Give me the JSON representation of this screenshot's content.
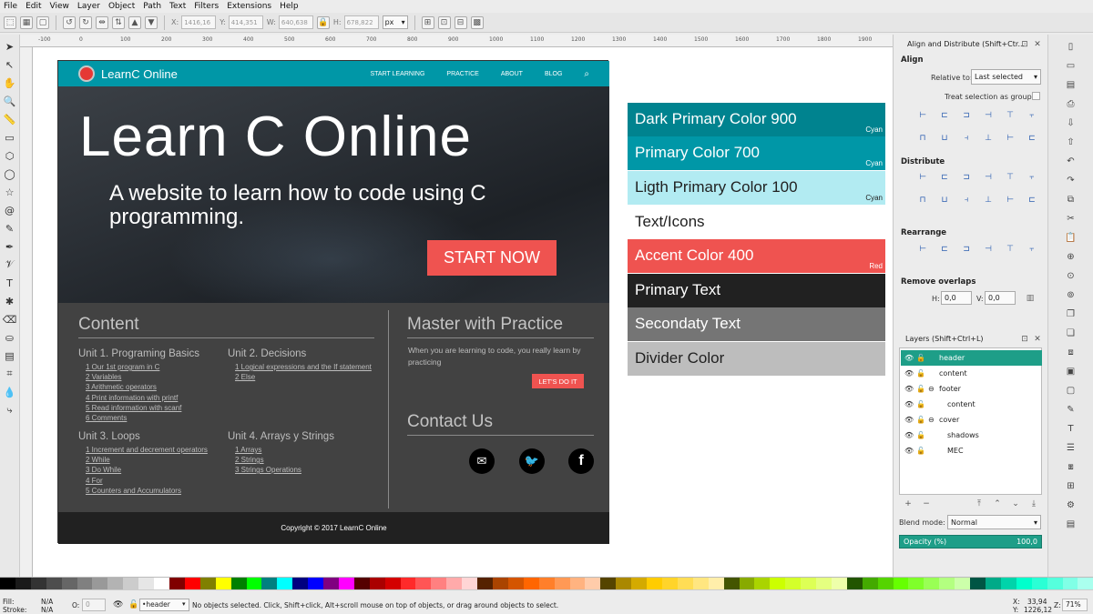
{
  "menubar": [
    "File",
    "Edit",
    "View",
    "Layer",
    "Object",
    "Path",
    "Text",
    "Filters",
    "Extensions",
    "Help"
  ],
  "controls": {
    "x_label": "X:",
    "x_value": "1416,16",
    "y_label": "Y:",
    "y_value": "414,351",
    "w_label": "W:",
    "w_value": "640,638",
    "h_label": "H:",
    "h_value": "678,822",
    "unit": "px"
  },
  "ruler_ticks": [
    "-100",
    "0",
    "100",
    "200",
    "300",
    "400",
    "500",
    "600",
    "700",
    "800",
    "900",
    "1000",
    "1100",
    "1200",
    "1300",
    "1400",
    "1500",
    "1600",
    "1700",
    "1800",
    "1900",
    "2k"
  ],
  "mockup": {
    "brand": "LearnC Online",
    "nav": [
      "START LEARNING",
      "PRACTICE",
      "ABOUT",
      "BLOG"
    ],
    "hero_title": "Learn C Online",
    "hero_subtitle": "A website to learn how to code using C programming.",
    "cta": "START NOW",
    "content_heading": "Content",
    "units": [
      {
        "title": "Unit 1. Programing Basics",
        "lessons": [
          "1 Our 1st program in C",
          "2 Variables",
          "3 Arithmetic operators",
          "4 Print information with printf",
          "5 Read information with scanf",
          "6 Comments"
        ]
      },
      {
        "title": "Unit 2. Decisions",
        "lessons": [
          "1 Logical expressions and the If statement",
          "2 Else"
        ]
      },
      {
        "title": "Unit 3. Loops",
        "lessons": [
          "1 Increment and decrement operators",
          "2 While",
          "3 Do While",
          "4 For",
          "5 Counters and Accumulators"
        ]
      },
      {
        "title": "Unit 4. Arrays y Strings",
        "lessons": [
          "1 Arrays",
          "2 Strings",
          "3 Strings Operations"
        ]
      }
    ],
    "practice_heading": "Master with Practice",
    "practice_text": "When you are learning to code, you really learn by practicing",
    "practice_button": "LET'S DO IT",
    "contact_heading": "Contact Us",
    "footer": "Copyright © 2017 LearnC Online"
  },
  "swatches": [
    {
      "name": "Dark Primary Color 900",
      "tag": "Cyan",
      "bg": "#00838f",
      "fg": "#ffffff"
    },
    {
      "name": "Primary Color 700",
      "tag": "Cyan",
      "bg": "#0097a7",
      "fg": "#ffffff"
    },
    {
      "name": "Ligth Primary Color 100",
      "tag": "Cyan",
      "bg": "#b2ebf2",
      "fg": "#212121"
    },
    {
      "name": "Text/Icons",
      "tag": "",
      "bg": "#ffffff",
      "fg": "#212121"
    },
    {
      "name": "Accent Color 400",
      "tag": "Red",
      "bg": "#ef5350",
      "fg": "#ffffff"
    },
    {
      "name": "Primary Text",
      "tag": "",
      "bg": "#212121",
      "fg": "#ffffff"
    },
    {
      "name": "Secondaty Text",
      "tag": "",
      "bg": "#757575",
      "fg": "#ffffff"
    },
    {
      "name": "Divider Color",
      "tag": "",
      "bg": "#bdbdbd",
      "fg": "#212121"
    }
  ],
  "align_panel": {
    "title": "Align and Distribute (Shift+Ctr...",
    "align": "Align",
    "relative_label": "Relative to:",
    "relative_value": "Last selected",
    "group_label": "Treat selection as group:",
    "distribute": "Distribute",
    "rearrange": "Rearrange",
    "remove_overlaps": "Remove overlaps",
    "h_label": "H:",
    "h_value": "0,0",
    "v_label": "V:",
    "v_value": "0,0"
  },
  "layers_panel": {
    "title": "Layers (Shift+Ctrl+L)",
    "layers": [
      "header",
      "content",
      "footer",
      "content",
      "cover",
      "shadows",
      "MEC"
    ],
    "blend_label": "Blend mode:",
    "blend_value": "Normal",
    "opacity_label": "Opacity (%)",
    "opacity_value": "100,0"
  },
  "statusbar": {
    "fill_label": "Fill:",
    "fill_value": "N/A",
    "stroke_label": "Stroke:",
    "stroke_value": "N/A",
    "o_label": "O:",
    "o_value": "0",
    "layer": "•header",
    "message": "No objects selected. Click, Shift+click, Alt+scroll mouse on top of objects, or drag around objects to select.",
    "x_label": "X:",
    "x_value": "33,94",
    "y_label": "Y:",
    "y_value": "1226,12",
    "z_label": "Z:",
    "zoom": "71%"
  },
  "palette_colors": [
    "#000000",
    "#1a1a1a",
    "#333333",
    "#4d4d4d",
    "#666666",
    "#808080",
    "#999999",
    "#b3b3b3",
    "#cccccc",
    "#e6e6e6",
    "#ffffff",
    "#800000",
    "#ff0000",
    "#808000",
    "#ffff00",
    "#008000",
    "#00ff00",
    "#008080",
    "#00ffff",
    "#000080",
    "#0000ff",
    "#800080",
    "#ff00ff",
    "#550000",
    "#aa0000",
    "#d40000",
    "#ff2a2a",
    "#ff5555",
    "#ff8080",
    "#ffaaaa",
    "#ffd5d5",
    "#552200",
    "#aa4400",
    "#d45500",
    "#ff6600",
    "#ff7f2a",
    "#ff9955",
    "#ffb380",
    "#ffccaa",
    "#554400",
    "#aa8800",
    "#d4aa00",
    "#ffcc00",
    "#ffd42a",
    "#ffdd55",
    "#ffe680",
    "#ffeeaa",
    "#445500",
    "#88aa00",
    "#aad400",
    "#ccff00",
    "#d4ff2a",
    "#ddff55",
    "#e5ff80",
    "#eeffaa",
    "#225500",
    "#44aa00",
    "#55d400",
    "#66ff00",
    "#7fff2a",
    "#99ff55",
    "#b3ff80",
    "#ccffaa",
    "#005544",
    "#00aa88",
    "#00d4aa",
    "#00ffcc",
    "#2affd5",
    "#55ffdd",
    "#80ffe6",
    "#aaffee"
  ]
}
